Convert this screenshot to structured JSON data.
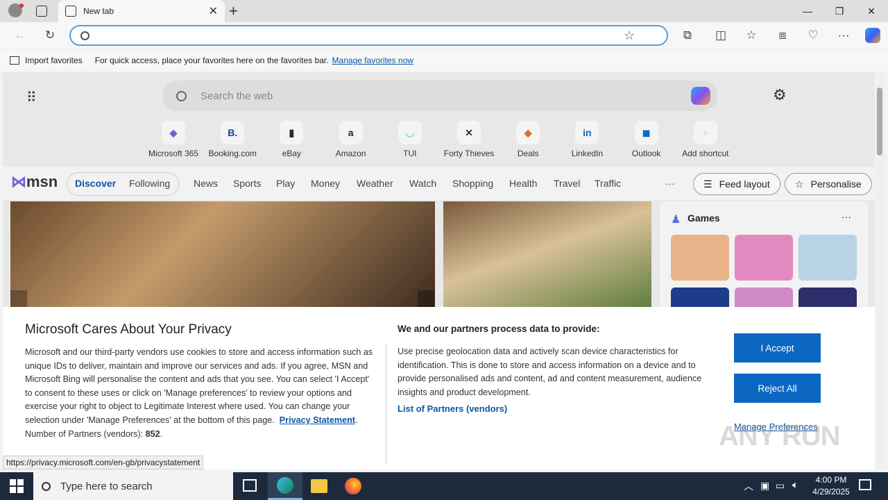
{
  "browser": {
    "tab_title": "New tab",
    "tab_close": "✕",
    "new_tab": "+",
    "window": {
      "minimize": "—",
      "restore": "❐",
      "close": "✕"
    },
    "address_value": "",
    "favbar": {
      "import_label": "Import favorites",
      "hint": "For quick access, place your favorites here on the favorites bar.",
      "manage_link": "Manage favorites now"
    }
  },
  "newtab": {
    "search_placeholder": "Search the web",
    "shortcuts": [
      {
        "label": "Microsoft 365",
        "glyph": "◆",
        "color": "#7b5bd6"
      },
      {
        "label": "Booking.com",
        "glyph": "B.",
        "color": "#1d3b87"
      },
      {
        "label": "eBay",
        "glyph": "▮",
        "color": "#2b2b2b"
      },
      {
        "label": "Amazon",
        "glyph": "a",
        "color": "#222222"
      },
      {
        "label": "TUI",
        "glyph": "◡",
        "color": "#8fc7e8"
      },
      {
        "label": "Forty Thieves",
        "glyph": "✕",
        "color": "#333333"
      },
      {
        "label": "Deals",
        "glyph": "◆",
        "color": "#e06d2b"
      },
      {
        "label": "LinkedIn",
        "glyph": "in",
        "color": "#0a66c2"
      },
      {
        "label": "Outlook",
        "glyph": "◼",
        "color": "#0f6cbd"
      },
      {
        "label": "Add shortcut",
        "glyph": "+",
        "color": "#dddddd"
      }
    ],
    "msn_logo": "msn",
    "nav": {
      "discover": "Discover",
      "following": "Following",
      "items": [
        "News",
        "Sports",
        "Play",
        "Money",
        "Weather",
        "Watch",
        "Shopping",
        "Health",
        "Travel",
        "Traffic"
      ],
      "more": "···",
      "feed_layout": "Feed layout",
      "personalise": "Personalise"
    },
    "games": {
      "title": "Games",
      "more": "···"
    }
  },
  "privacy": {
    "title": "Microsoft Cares About Your Privacy",
    "body": "Microsoft and our third-party vendors use cookies to store and access information such as unique IDs to deliver, maintain and improve our services and ads. If you agree, MSN and Microsoft Bing will personalise the content and ads that you see. You can select 'I Accept' to consent to these uses or click on 'Manage preferences' to review your options and exercise your right to object to Legitimate Interest where used.  You can change your selection under 'Manage Preferences' at the bottom of this page.",
    "privacy_link": "Privacy Statement",
    "partners_count_label": "Number of Partners (vendors):",
    "partners_count": "852",
    "right_title": "We and our partners process data to provide:",
    "right_body": "Use precise geolocation data and actively scan device characteristics for identification. This is done to store and access information on a device and to provide personalised ads and content, ad and content measurement, audience insights and product development.",
    "partners_link": "List of Partners (vendors)",
    "accept": "I Accept",
    "reject": "Reject All",
    "manage": "Manage Preferences"
  },
  "status_url": "https://privacy.microsoft.com/en-gb/privacystatement",
  "taskbar": {
    "search_placeholder": "Type here to search",
    "time": "4:00 PM",
    "date": "4/29/2025"
  },
  "watermark": "ANY RUN"
}
